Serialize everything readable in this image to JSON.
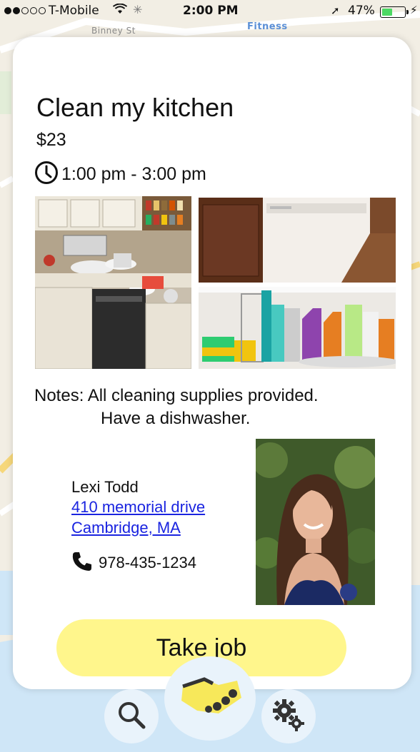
{
  "status_bar": {
    "carrier": "T-Mobile",
    "time": "2:00 PM",
    "battery": "47%",
    "battery_level": 0.47
  },
  "map": {
    "street_label": "Binney St",
    "place_label": "Fitness"
  },
  "job": {
    "title": "Clean my kitchen",
    "price": "$23",
    "time_range": "1:00 pm - 3:00 pm",
    "notes_line1": "Notes: All cleaning supplies provided.",
    "notes_line2": "Have a dishwasher."
  },
  "poster": {
    "name": "Lexi Todd",
    "address_line1": "410 memorial drive",
    "address_line2": "Cambridge, MA",
    "phone": "978-435-1234"
  },
  "actions": {
    "take_job_label": "Take job"
  },
  "nav": {
    "items": [
      "search-icon",
      "handshake-icon",
      "gear-icon"
    ]
  },
  "colors": {
    "accent_yellow": "#fff68c",
    "link_blue": "#1a24e0",
    "nav_bubble": "#e9f3fb"
  }
}
